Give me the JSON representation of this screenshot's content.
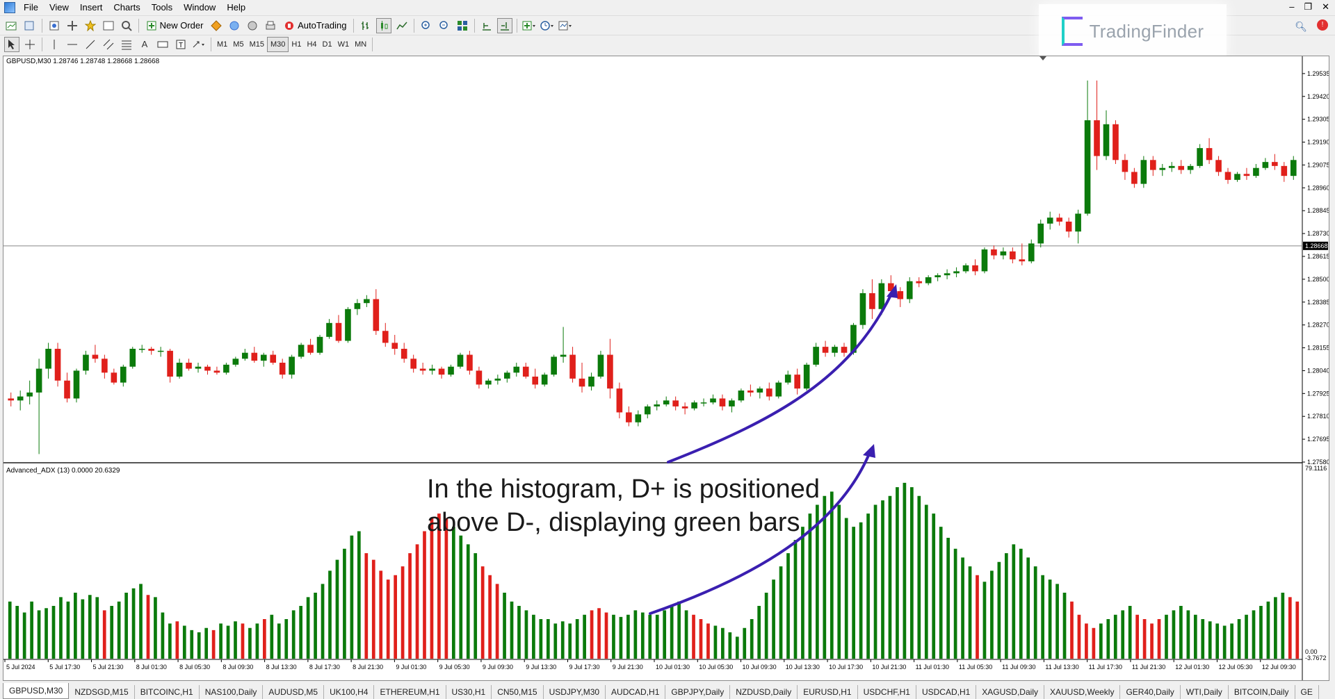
{
  "menu": [
    "File",
    "View",
    "Insert",
    "Charts",
    "Tools",
    "Window",
    "Help"
  ],
  "toolbar": {
    "new_order": "New Order",
    "autotrading": "AutoTrading"
  },
  "timeframes": [
    "M1",
    "M5",
    "M15",
    "M30",
    "H1",
    "H4",
    "D1",
    "W1",
    "MN"
  ],
  "active_timeframe": "M30",
  "brand": {
    "name": "TradingFinder"
  },
  "main_chart": {
    "title": "GBPUSD,M30  1.28746 1.28748 1.28668 1.28668",
    "current_price": "1.28668",
    "price_labels": [
      "1.29535",
      "1.29420",
      "1.29305",
      "1.29190",
      "1.29075",
      "1.28960",
      "1.28845",
      "1.28730",
      "1.28615",
      "1.28500",
      "1.28385",
      "1.28270",
      "1.28155",
      "1.28040",
      "1.27925",
      "1.27810",
      "1.27695",
      "1.27580"
    ],
    "colors": {
      "bull": "#0b7a0b",
      "bear": "#e0201b",
      "current_line": "#888888"
    }
  },
  "indicator": {
    "title": "Advanced_ADX (13) 0.0000 20.6329",
    "scale_top": "79.1116",
    "scale_bottom": [
      "0.00",
      "-3.7672"
    ]
  },
  "annotation": {
    "line1": "In the histogram, D+ is positioned",
    "line2": "above D-, displaying green bars",
    "arrow_color": "#3a1fb0"
  },
  "time_labels": [
    "5 Jul 2024",
    "5 Jul 17:30",
    "5 Jul 21:30",
    "8 Jul 01:30",
    "8 Jul 05:30",
    "8 Jul 09:30",
    "8 Jul 13:30",
    "8 Jul 17:30",
    "8 Jul 21:30",
    "9 Jul 01:30",
    "9 Jul 05:30",
    "9 Jul 09:30",
    "9 Jul 13:30",
    "9 Jul 17:30",
    "9 Jul 21:30",
    "10 Jul 01:30",
    "10 Jul 05:30",
    "10 Jul 09:30",
    "10 Jul 13:30",
    "10 Jul 17:30",
    "10 Jul 21:30",
    "11 Jul 01:30",
    "11 Jul 05:30",
    "11 Jul 09:30",
    "11 Jul 13:30",
    "11 Jul 17:30",
    "11 Jul 21:30",
    "12 Jul 01:30",
    "12 Jul 05:30",
    "12 Jul 09:30"
  ],
  "tabs": [
    "GBPUSD,M30",
    "NZDSGD,M15",
    "BITCOINC,H1",
    "NAS100,Daily",
    "AUDUSD,M5",
    "UK100,H4",
    "ETHEREUM,H1",
    "US30,H1",
    "CN50,M15",
    "USDJPY,M30",
    "AUDCAD,H1",
    "GBPJPY,Daily",
    "NZDUSD,Daily",
    "EURUSD,H1",
    "USDCHF,H1",
    "USDCAD,H1",
    "XAGUSD,Daily",
    "XAUUSD,Weekly",
    "GER40,Daily",
    "WTI,Daily",
    "BITCOIN,Daily",
    "GE"
  ],
  "chart_data": {
    "type": "candlestick",
    "symbol": "GBPUSD",
    "timeframe": "M30",
    "ylim": [
      1.2758,
      1.2958
    ],
    "candles": [
      [
        1.279,
        1.2793,
        1.2786,
        1.2789
      ],
      [
        1.2789,
        1.2794,
        1.2784,
        1.2791
      ],
      [
        1.2791,
        1.2799,
        1.2787,
        1.2793
      ],
      [
        1.2793,
        1.281,
        1.2762,
        1.2805
      ],
      [
        1.2805,
        1.2818,
        1.28,
        1.2815
      ],
      [
        1.2815,
        1.2818,
        1.2796,
        1.2799
      ],
      [
        1.2799,
        1.2803,
        1.2788,
        1.279
      ],
      [
        1.279,
        1.2805,
        1.2788,
        1.2804
      ],
      [
        1.2804,
        1.2814,
        1.2802,
        1.2812
      ],
      [
        1.2812,
        1.2817,
        1.2808,
        1.281
      ],
      [
        1.281,
        1.2812,
        1.28,
        1.2803
      ],
      [
        1.2803,
        1.2805,
        1.2797,
        1.2798
      ],
      [
        1.2798,
        1.2807,
        1.2796,
        1.2806
      ],
      [
        1.2806,
        1.2816,
        1.2805,
        1.2815
      ],
      [
        1.2815,
        1.2817,
        1.2813,
        1.2815
      ],
      [
        1.2815,
        1.2816,
        1.2812,
        1.2814
      ],
      [
        1.2814,
        1.2816,
        1.2811,
        1.2814
      ],
      [
        1.2814,
        1.2815,
        1.2798,
        1.2801
      ],
      [
        1.2801,
        1.281,
        1.28,
        1.2808
      ],
      [
        1.2808,
        1.281,
        1.2804,
        1.2805
      ],
      [
        1.2805,
        1.2808,
        1.2803,
        1.2806
      ],
      [
        1.2806,
        1.2807,
        1.2802,
        1.2804
      ],
      [
        1.2804,
        1.2806,
        1.2802,
        1.2803
      ],
      [
        1.2803,
        1.2808,
        1.2802,
        1.2807
      ],
      [
        1.2807,
        1.2811,
        1.2806,
        1.281
      ],
      [
        1.281,
        1.2815,
        1.2809,
        1.2813
      ],
      [
        1.2813,
        1.2816,
        1.2808,
        1.2809
      ],
      [
        1.2809,
        1.2813,
        1.2806,
        1.2812
      ],
      [
        1.2812,
        1.2814,
        1.2807,
        1.2808
      ],
      [
        1.2808,
        1.281,
        1.28,
        1.2802
      ],
      [
        1.2802,
        1.2812,
        1.28,
        1.2811
      ],
      [
        1.2811,
        1.2818,
        1.281,
        1.2817
      ],
      [
        1.2817,
        1.282,
        1.2812,
        1.2813
      ],
      [
        1.2813,
        1.2822,
        1.2812,
        1.2821
      ],
      [
        1.2821,
        1.283,
        1.282,
        1.2828
      ],
      [
        1.2828,
        1.2832,
        1.2818,
        1.2819
      ],
      [
        1.2819,
        1.2836,
        1.2818,
        1.2835
      ],
      [
        1.2835,
        1.284,
        1.2832,
        1.2838
      ],
      [
        1.2838,
        1.2842,
        1.2836,
        1.284
      ],
      [
        1.284,
        1.2845,
        1.2822,
        1.2824
      ],
      [
        1.2824,
        1.2828,
        1.2816,
        1.2818
      ],
      [
        1.2818,
        1.2822,
        1.2812,
        1.2815
      ],
      [
        1.2815,
        1.2818,
        1.2808,
        1.281
      ],
      [
        1.281,
        1.2812,
        1.2803,
        1.2805
      ],
      [
        1.2805,
        1.2808,
        1.2802,
        1.2804
      ],
      [
        1.2804,
        1.2807,
        1.2802,
        1.2805
      ],
      [
        1.2805,
        1.2806,
        1.28,
        1.2802
      ],
      [
        1.2802,
        1.2807,
        1.2801,
        1.2806
      ],
      [
        1.2806,
        1.2813,
        1.2805,
        1.2812
      ],
      [
        1.2812,
        1.2814,
        1.2802,
        1.2804
      ],
      [
        1.2804,
        1.2806,
        1.2795,
        1.2797
      ],
      [
        1.2797,
        1.28,
        1.2795,
        1.2799
      ],
      [
        1.2799,
        1.2802,
        1.2797,
        1.28
      ],
      [
        1.28,
        1.2804,
        1.2798,
        1.2803
      ],
      [
        1.2803,
        1.2808,
        1.2801,
        1.2806
      ],
      [
        1.2806,
        1.2808,
        1.28,
        1.2801
      ],
      [
        1.2801,
        1.2805,
        1.2795,
        1.2797
      ],
      [
        1.2797,
        1.2803,
        1.2796,
        1.2802
      ],
      [
        1.2802,
        1.2812,
        1.2801,
        1.2811
      ],
      [
        1.2811,
        1.2826,
        1.2808,
        1.2812
      ],
      [
        1.2812,
        1.2816,
        1.2798,
        1.28
      ],
      [
        1.28,
        1.2808,
        1.2793,
        1.2796
      ],
      [
        1.2796,
        1.2803,
        1.2794,
        1.2801
      ],
      [
        1.2801,
        1.2814,
        1.28,
        1.2812
      ],
      [
        1.2812,
        1.282,
        1.279,
        1.2795
      ],
      [
        1.2795,
        1.2798,
        1.278,
        1.2783
      ],
      [
        1.2783,
        1.2786,
        1.2776,
        1.2778
      ],
      [
        1.2778,
        1.2784,
        1.2776,
        1.2782
      ],
      [
        1.2782,
        1.2787,
        1.278,
        1.2786
      ],
      [
        1.2786,
        1.2789,
        1.2784,
        1.2787
      ],
      [
        1.2787,
        1.2791,
        1.2786,
        1.2789
      ],
      [
        1.2789,
        1.2791,
        1.2784,
        1.2786
      ],
      [
        1.2786,
        1.2788,
        1.2782,
        1.2785
      ],
      [
        1.2785,
        1.2789,
        1.2784,
        1.2788
      ],
      [
        1.2788,
        1.279,
        1.2786,
        1.2788
      ],
      [
        1.2788,
        1.2792,
        1.2787,
        1.279
      ],
      [
        1.279,
        1.2792,
        1.2784,
        1.2786
      ],
      [
        1.2786,
        1.279,
        1.2783,
        1.2789
      ],
      [
        1.2789,
        1.2795,
        1.2788,
        1.2794
      ],
      [
        1.2794,
        1.2797,
        1.2791,
        1.2793
      ],
      [
        1.2793,
        1.2796,
        1.279,
        1.2795
      ],
      [
        1.2795,
        1.2798,
        1.2789,
        1.2791
      ],
      [
        1.2791,
        1.2799,
        1.279,
        1.2798
      ],
      [
        1.2798,
        1.2804,
        1.2797,
        1.2802
      ],
      [
        1.2802,
        1.2805,
        1.2792,
        1.2795
      ],
      [
        1.2795,
        1.2808,
        1.2794,
        1.2807
      ],
      [
        1.2807,
        1.2818,
        1.2806,
        1.2816
      ],
      [
        1.2816,
        1.2819,
        1.2811,
        1.2813
      ],
      [
        1.2813,
        1.2817,
        1.2811,
        1.2816
      ],
      [
        1.2816,
        1.2818,
        1.2811,
        1.2813
      ],
      [
        1.2813,
        1.2828,
        1.2812,
        1.2827
      ],
      [
        1.2827,
        1.2845,
        1.2825,
        1.2843
      ],
      [
        1.2843,
        1.285,
        1.283,
        1.2835
      ],
      [
        1.2835,
        1.285,
        1.2832,
        1.2848
      ],
      [
        1.2848,
        1.2852,
        1.2842,
        1.2844
      ],
      [
        1.2844,
        1.2846,
        1.2836,
        1.284
      ],
      [
        1.284,
        1.2851,
        1.2838,
        1.2849
      ],
      [
        1.2849,
        1.2851,
        1.2846,
        1.2848
      ],
      [
        1.2848,
        1.2852,
        1.2847,
        1.2851
      ],
      [
        1.2851,
        1.2853,
        1.2849,
        1.2852
      ],
      [
        1.2852,
        1.2855,
        1.285,
        1.2853
      ],
      [
        1.2853,
        1.2856,
        1.2851,
        1.2854
      ],
      [
        1.2854,
        1.2858,
        1.2853,
        1.2857
      ],
      [
        1.2857,
        1.286,
        1.2852,
        1.2854
      ],
      [
        1.2854,
        1.2866,
        1.2853,
        1.2865
      ],
      [
        1.2865,
        1.2867,
        1.286,
        1.2862
      ],
      [
        1.2862,
        1.2866,
        1.286,
        1.2864
      ],
      [
        1.2864,
        1.2866,
        1.2858,
        1.286
      ],
      [
        1.286,
        1.2868,
        1.2857,
        1.2859
      ],
      [
        1.2859,
        1.287,
        1.2858,
        1.2868
      ],
      [
        1.2868,
        1.288,
        1.2866,
        1.2878
      ],
      [
        1.2878,
        1.2884,
        1.2875,
        1.2881
      ],
      [
        1.2881,
        1.2883,
        1.2877,
        1.2879
      ],
      [
        1.2879,
        1.2881,
        1.2871,
        1.2874
      ],
      [
        1.2874,
        1.2885,
        1.2868,
        1.2883
      ],
      [
        1.2883,
        1.295,
        1.2882,
        1.293
      ],
      [
        1.293,
        1.295,
        1.2905,
        1.2912
      ],
      [
        1.2912,
        1.2935,
        1.291,
        1.2928
      ],
      [
        1.2928,
        1.293,
        1.2908,
        1.291
      ],
      [
        1.291,
        1.2913,
        1.29,
        1.2904
      ],
      [
        1.2904,
        1.2906,
        1.2896,
        1.2898
      ],
      [
        1.2898,
        1.2912,
        1.2896,
        1.291
      ],
      [
        1.291,
        1.2912,
        1.2902,
        1.2905
      ],
      [
        1.2905,
        1.2908,
        1.2902,
        1.2906
      ],
      [
        1.2906,
        1.2909,
        1.2904,
        1.2907
      ],
      [
        1.2907,
        1.291,
        1.2903,
        1.2905
      ],
      [
        1.2905,
        1.2908,
        1.2903,
        1.2907
      ],
      [
        1.2907,
        1.2918,
        1.2906,
        1.2916
      ],
      [
        1.2916,
        1.2921,
        1.2908,
        1.291
      ],
      [
        1.291,
        1.2912,
        1.2902,
        1.2904
      ],
      [
        1.2904,
        1.2906,
        1.2898,
        1.29
      ],
      [
        1.29,
        1.2904,
        1.2899,
        1.2903
      ],
      [
        1.2903,
        1.2906,
        1.29,
        1.2902
      ],
      [
        1.2902,
        1.2908,
        1.2901,
        1.2906
      ],
      [
        1.2906,
        1.2911,
        1.2905,
        1.2909
      ],
      [
        1.2909,
        1.2913,
        1.2905,
        1.2907
      ],
      [
        1.2907,
        1.2909,
        1.2899,
        1.2902
      ],
      [
        1.2902,
        1.2912,
        1.29,
        1.291
      ]
    ],
    "adx": {
      "type": "bar",
      "ylim": [
        0,
        79.1116
      ],
      "values": [
        26,
        24,
        21,
        26,
        22,
        23,
        24,
        28,
        26,
        30,
        27,
        29,
        28,
        22,
        24,
        26,
        30,
        32,
        34,
        29,
        28,
        21,
        16,
        17,
        15,
        13,
        12,
        14,
        13,
        16,
        15,
        17,
        16,
        14,
        16,
        18,
        20,
        16,
        18,
        22,
        24,
        28,
        30,
        34,
        40,
        45,
        50,
        56,
        58,
        48,
        45,
        40,
        36,
        38,
        42,
        48,
        52,
        58,
        64,
        66,
        64,
        60,
        56,
        52,
        48,
        42,
        38,
        34,
        30,
        26,
        24,
        22,
        20,
        18,
        18,
        16,
        17,
        16,
        18,
        20,
        22,
        23,
        21,
        20,
        19,
        20,
        22,
        21,
        20,
        20,
        22,
        24,
        26,
        22,
        20,
        18,
        16,
        15,
        14,
        12,
        10,
        14,
        18,
        24,
        30,
        36,
        42,
        48,
        54,
        60,
        66,
        70,
        74,
        76,
        70,
        64,
        60,
        62,
        66,
        70,
        72,
        74,
        78,
        80,
        78,
        74,
        70,
        66,
        60,
        55,
        50,
        46,
        42,
        38,
        35,
        40,
        44,
        48,
        52,
        50,
        46,
        42,
        38,
        36,
        34,
        30,
        26,
        20,
        16,
        14,
        16,
        18,
        20,
        22,
        24,
        20,
        18,
        16,
        18,
        20,
        22,
        24,
        22,
        20,
        18,
        17,
        16,
        15,
        16,
        18,
        20,
        22,
        24,
        26,
        28,
        30,
        28,
        26
      ],
      "positive": [
        true,
        true,
        true,
        true,
        true,
        true,
        true,
        true,
        true,
        true,
        true,
        true,
        true,
        false,
        true,
        true,
        true,
        true,
        true,
        false,
        true,
        true,
        true,
        false,
        true,
        true,
        true,
        true,
        false,
        true,
        true,
        true,
        false,
        true,
        true,
        false,
        true,
        true,
        true,
        true,
        true,
        true,
        true,
        true,
        true,
        true,
        true,
        true,
        true,
        false,
        false,
        false,
        false,
        false,
        false,
        false,
        false,
        false,
        false,
        false,
        false,
        true,
        true,
        true,
        true,
        false,
        false,
        false,
        true,
        true,
        true,
        true,
        true,
        true,
        true,
        true,
        true,
        true,
        true,
        true,
        false,
        false,
        false,
        true,
        true,
        true,
        true,
        true,
        true,
        true,
        true,
        true,
        true,
        true,
        false,
        false,
        false,
        true,
        true,
        true,
        true,
        true,
        true,
        true,
        true,
        true,
        true,
        true,
        true,
        true,
        true,
        true,
        true,
        true,
        true,
        true,
        true,
        true,
        true,
        true,
        true,
        true,
        true,
        true,
        true,
        true,
        true,
        true,
        true,
        true,
        true,
        true,
        true,
        false,
        true,
        true,
        true,
        true,
        true,
        true,
        true,
        true,
        true,
        true,
        true,
        true,
        false,
        false,
        false,
        false,
        true,
        true,
        true,
        true,
        true,
        false,
        false,
        false,
        false,
        true,
        true,
        true,
        true,
        true,
        true,
        true,
        true,
        true,
        true,
        true,
        true,
        true,
        true,
        true,
        true,
        true
      ]
    }
  }
}
